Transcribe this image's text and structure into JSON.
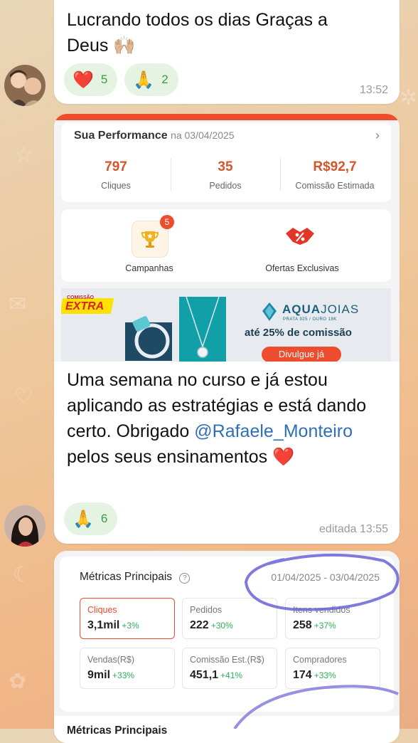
{
  "messages": [
    {
      "text_line1": "Lucrando todos os dias Graças a",
      "text_line2": "Deus",
      "text_emoji": "🙌🏼",
      "reactions": [
        {
          "emoji": "❤️",
          "count": "5"
        },
        {
          "emoji": "🙏",
          "count": "2"
        }
      ],
      "time": "13:52"
    },
    {
      "text_part1": "Uma semana no curso e já estou aplicando as estratégias e está dando certo. Obrigado ",
      "mention": "@Rafaele_Monteiro",
      "text_part2": " pelos seus ensinamentos",
      "text_emoji": "❤️",
      "reactions": [
        {
          "emoji": "🙏",
          "count": "6"
        }
      ],
      "time": "editada 13:55"
    }
  ],
  "performance": {
    "title": "Sua Performance",
    "date": "na 03/04/2025",
    "stats": [
      {
        "value": "797",
        "label": "Cliques"
      },
      {
        "value": "35",
        "label": "Pedidos"
      },
      {
        "value": "R$92,7",
        "label": "Comissão Estimada"
      }
    ],
    "features": [
      {
        "label": "Campanhas",
        "badge": "5",
        "icon": "trophy-icon"
      },
      {
        "label": "Ofertas Exclusivas",
        "icon": "handshake-icon"
      }
    ],
    "banner": {
      "tag_small": "COMISSÃO",
      "tag": "EXTRA",
      "brand": "AQUA",
      "brand_suffix": "JOIAS",
      "brand_sub": "PRATA 925 / OURO 18K",
      "offer": "até 25% de comissão",
      "cta": "Divulgue já"
    }
  },
  "metrics": {
    "title": "Métricas Principais",
    "range": "01/04/2025 - 03/04/2025",
    "items": [
      {
        "label": "Cliques",
        "value": "3,1mil",
        "delta": "+3%"
      },
      {
        "label": "Pedidos",
        "value": "222",
        "delta": "+30%"
      },
      {
        "label": "Itens vendidos",
        "value": "258",
        "delta": "+37%"
      },
      {
        "label": "Vendas(R$)",
        "value": "9mil",
        "delta": "+33%"
      },
      {
        "label": "Comissão Est.(R$)",
        "value": "451,1",
        "delta": "+41%"
      },
      {
        "label": "Compradores",
        "value": "174",
        "delta": "+33%"
      }
    ],
    "next_title": "Métricas Principais"
  },
  "colors": {
    "accent": "#ee4d2d",
    "reaction_bg": "#e5f3e2",
    "mention": "#2f6fb8",
    "annotation": "#6a63d6"
  }
}
